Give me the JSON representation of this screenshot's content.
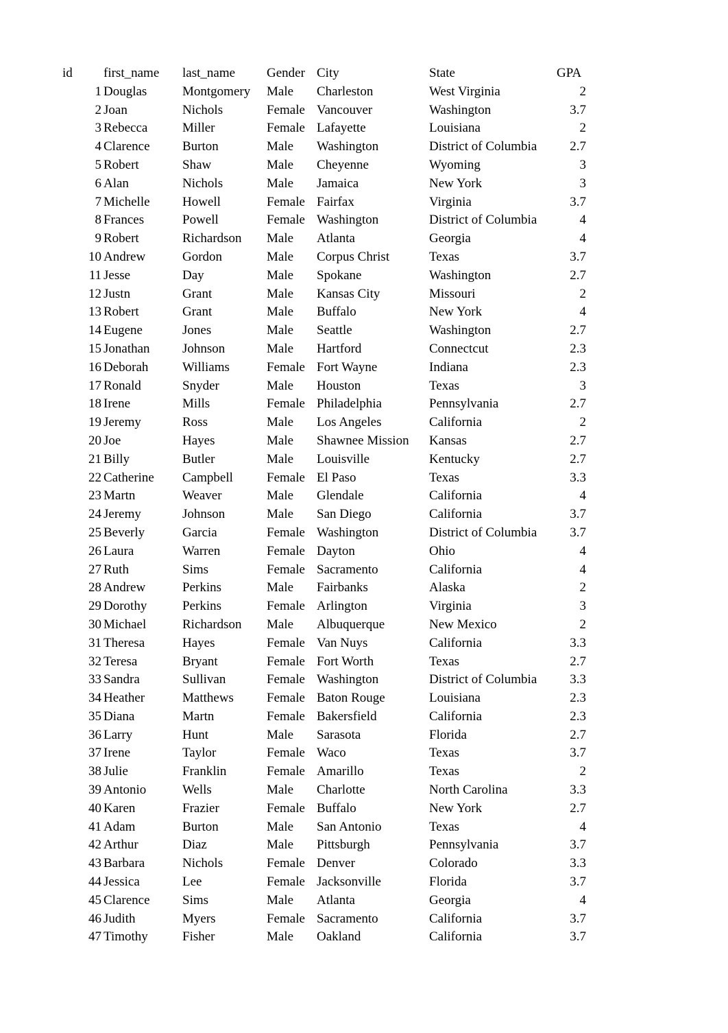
{
  "table": {
    "headers": {
      "id": "id",
      "first_name": "first_name",
      "last_name": "last_name",
      "gender": "Gender",
      "city": "City",
      "state": "State",
      "gpa": "GPA"
    },
    "rows": [
      {
        "id": "1",
        "first_name": "Douglas",
        "last_name": "Montgomery",
        "gender": "Male",
        "city": "Charleston",
        "state": "West Virginia",
        "gpa": "2"
      },
      {
        "id": "2",
        "first_name": "Joan",
        "last_name": "Nichols",
        "gender": "Female",
        "city": "Vancouver",
        "state": "Washington",
        "gpa": "3.7"
      },
      {
        "id": "3",
        "first_name": "Rebecca",
        "last_name": "Miller",
        "gender": "Female",
        "city": "Lafayette",
        "state": "Louisiana",
        "gpa": "2"
      },
      {
        "id": "4",
        "first_name": "Clarence",
        "last_name": "Burton",
        "gender": "Male",
        "city": "Washington",
        "state": "District of Columbia",
        "gpa": "2.7"
      },
      {
        "id": "5",
        "first_name": "Robert",
        "last_name": "Shaw",
        "gender": "Male",
        "city": "Cheyenne",
        "state": "Wyoming",
        "gpa": "3"
      },
      {
        "id": "6",
        "first_name": "Alan",
        "last_name": "Nichols",
        "gender": "Male",
        "city": "Jamaica",
        "state": "New York",
        "gpa": "3"
      },
      {
        "id": "7",
        "first_name": "Michelle",
        "last_name": "Howell",
        "gender": "Female",
        "city": "Fairfax",
        "state": "Virginia",
        "gpa": "3.7"
      },
      {
        "id": "8",
        "first_name": "Frances",
        "last_name": "Powell",
        "gender": "Female",
        "city": "Washington",
        "state": "District of Columbia",
        "gpa": "4"
      },
      {
        "id": "9",
        "first_name": "Robert",
        "last_name": "Richardson",
        "gender": "Male",
        "city": "Atlanta",
        "state": "Georgia",
        "gpa": "4"
      },
      {
        "id": "10",
        "first_name": "Andrew",
        "last_name": "Gordon",
        "gender": "Male",
        "city": "Corpus Christ",
        "state": "Texas",
        "gpa": "3.7"
      },
      {
        "id": "11",
        "first_name": "Jesse",
        "last_name": "Day",
        "gender": "Male",
        "city": "Spokane",
        "state": "Washington",
        "gpa": "2.7"
      },
      {
        "id": "12",
        "first_name": "Justn",
        "last_name": "Grant",
        "gender": "Male",
        "city": "Kansas City",
        "state": "Missouri",
        "gpa": "2"
      },
      {
        "id": "13",
        "first_name": "Robert",
        "last_name": "Grant",
        "gender": "Male",
        "city": "Buffalo",
        "state": "New York",
        "gpa": "4"
      },
      {
        "id": "14",
        "first_name": "Eugene",
        "last_name": "Jones",
        "gender": "Male",
        "city": "Seattle",
        "state": "Washington",
        "gpa": "2.7"
      },
      {
        "id": "15",
        "first_name": "Jonathan",
        "last_name": "Johnson",
        "gender": "Male",
        "city": "Hartford",
        "state": "Connectcut",
        "gpa": "2.3"
      },
      {
        "id": "16",
        "first_name": "Deborah",
        "last_name": "Williams",
        "gender": "Female",
        "city": "Fort Wayne",
        "state": "Indiana",
        "gpa": "2.3"
      },
      {
        "id": "17",
        "first_name": "Ronald",
        "last_name": "Snyder",
        "gender": "Male",
        "city": "Houston",
        "state": "Texas",
        "gpa": "3"
      },
      {
        "id": "18",
        "first_name": "Irene",
        "last_name": "Mills",
        "gender": "Female",
        "city": "Philadelphia",
        "state": "Pennsylvania",
        "gpa": "2.7"
      },
      {
        "id": "19",
        "first_name": "Jeremy",
        "last_name": "Ross",
        "gender": "Male",
        "city": "Los Angeles",
        "state": "California",
        "gpa": "2"
      },
      {
        "id": "20",
        "first_name": "Joe",
        "last_name": "Hayes",
        "gender": "Male",
        "city": "Shawnee Mission",
        "state": "Kansas",
        "gpa": "2.7"
      },
      {
        "id": "21",
        "first_name": "Billy",
        "last_name": "Butler",
        "gender": "Male",
        "city": "Louisville",
        "state": "Kentucky",
        "gpa": "2.7"
      },
      {
        "id": "22",
        "first_name": "Catherine",
        "last_name": "Campbell",
        "gender": "Female",
        "city": "El Paso",
        "state": "Texas",
        "gpa": "3.3"
      },
      {
        "id": "23",
        "first_name": "Martn",
        "last_name": "Weaver",
        "gender": "Male",
        "city": "Glendale",
        "state": "California",
        "gpa": "4"
      },
      {
        "id": "24",
        "first_name": "Jeremy",
        "last_name": "Johnson",
        "gender": "Male",
        "city": "San Diego",
        "state": "California",
        "gpa": "3.7"
      },
      {
        "id": "25",
        "first_name": "Beverly",
        "last_name": "Garcia",
        "gender": "Female",
        "city": "Washington",
        "state": "District of Columbia",
        "gpa": "3.7"
      },
      {
        "id": "26",
        "first_name": "Laura",
        "last_name": "Warren",
        "gender": "Female",
        "city": "Dayton",
        "state": "Ohio",
        "gpa": "4"
      },
      {
        "id": "27",
        "first_name": "Ruth",
        "last_name": "Sims",
        "gender": "Female",
        "city": "Sacramento",
        "state": "California",
        "gpa": "4"
      },
      {
        "id": "28",
        "first_name": "Andrew",
        "last_name": "Perkins",
        "gender": "Male",
        "city": "Fairbanks",
        "state": "Alaska",
        "gpa": "2"
      },
      {
        "id": "29",
        "first_name": "Dorothy",
        "last_name": "Perkins",
        "gender": "Female",
        "city": "Arlington",
        "state": "Virginia",
        "gpa": "3"
      },
      {
        "id": "30",
        "first_name": "Michael",
        "last_name": "Richardson",
        "gender": "Male",
        "city": "Albuquerque",
        "state": "New Mexico",
        "gpa": "2"
      },
      {
        "id": "31",
        "first_name": "Theresa",
        "last_name": "Hayes",
        "gender": "Female",
        "city": "Van Nuys",
        "state": "California",
        "gpa": "3.3"
      },
      {
        "id": "32",
        "first_name": "Teresa",
        "last_name": "Bryant",
        "gender": "Female",
        "city": "Fort Worth",
        "state": "Texas",
        "gpa": "2.7"
      },
      {
        "id": "33",
        "first_name": "Sandra",
        "last_name": "Sullivan",
        "gender": "Female",
        "city": "Washington",
        "state": "District of Columbia",
        "gpa": "3.3"
      },
      {
        "id": "34",
        "first_name": "Heather",
        "last_name": "Matthews",
        "gender": "Female",
        "city": "Baton Rouge",
        "state": "Louisiana",
        "gpa": "2.3"
      },
      {
        "id": "35",
        "first_name": "Diana",
        "last_name": "Martn",
        "gender": "Female",
        "city": "Bakersfield",
        "state": "California",
        "gpa": "2.3"
      },
      {
        "id": "36",
        "first_name": "Larry",
        "last_name": "Hunt",
        "gender": "Male",
        "city": "Sarasota",
        "state": "Florida",
        "gpa": "2.7"
      },
      {
        "id": "37",
        "first_name": "Irene",
        "last_name": "Taylor",
        "gender": "Female",
        "city": "Waco",
        "state": "Texas",
        "gpa": "3.7"
      },
      {
        "id": "38",
        "first_name": "Julie",
        "last_name": "Franklin",
        "gender": "Female",
        "city": "Amarillo",
        "state": "Texas",
        "gpa": "2"
      },
      {
        "id": "39",
        "first_name": "Antonio",
        "last_name": "Wells",
        "gender": "Male",
        "city": "Charlotte",
        "state": "North Carolina",
        "gpa": "3.3"
      },
      {
        "id": "40",
        "first_name": "Karen",
        "last_name": "Frazier",
        "gender": "Female",
        "city": "Buffalo",
        "state": "New York",
        "gpa": "2.7"
      },
      {
        "id": "41",
        "first_name": "Adam",
        "last_name": "Burton",
        "gender": "Male",
        "city": "San Antonio",
        "state": "Texas",
        "gpa": "4"
      },
      {
        "id": "42",
        "first_name": "Arthur",
        "last_name": "Diaz",
        "gender": "Male",
        "city": "Pittsburgh",
        "state": "Pennsylvania",
        "gpa": "3.7"
      },
      {
        "id": "43",
        "first_name": "Barbara",
        "last_name": "Nichols",
        "gender": "Female",
        "city": "Denver",
        "state": "Colorado",
        "gpa": "3.3"
      },
      {
        "id": "44",
        "first_name": "Jessica",
        "last_name": "Lee",
        "gender": "Female",
        "city": "Jacksonville",
        "state": "Florida",
        "gpa": "3.7"
      },
      {
        "id": "45",
        "first_name": "Clarence",
        "last_name": "Sims",
        "gender": "Male",
        "city": "Atlanta",
        "state": "Georgia",
        "gpa": "4"
      },
      {
        "id": "46",
        "first_name": "Judith",
        "last_name": "Myers",
        "gender": "Female",
        "city": "Sacramento",
        "state": "California",
        "gpa": "3.7"
      },
      {
        "id": "47",
        "first_name": "Timothy",
        "last_name": "Fisher",
        "gender": "Male",
        "city": "Oakland",
        "state": "California",
        "gpa": "3.7"
      }
    ]
  }
}
